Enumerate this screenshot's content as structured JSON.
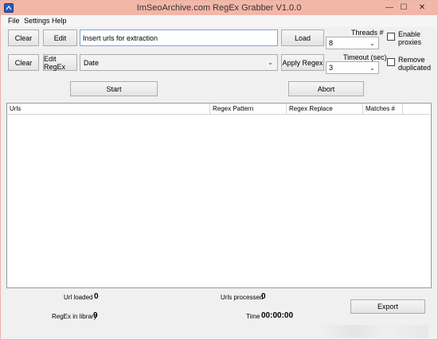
{
  "window": {
    "title": "ImSeoArchive.com RegEx Grabber V1.0.0",
    "controls": {
      "minimize": "—",
      "maximize": "☐",
      "close": "✕"
    }
  },
  "menu": [
    "File",
    "Settings",
    "Help"
  ],
  "row1": {
    "clear_label": "Clear",
    "edit_label": "Edit",
    "url_input_value": "Insert urls for extraction",
    "load_label": "Load",
    "threads_label": "Threads #",
    "threads_value": "8",
    "enable_proxies_label_1": "Enable",
    "enable_proxies_label_2": "proxies",
    "enable_proxies_checked": false
  },
  "row2": {
    "clear_label": "Clear",
    "edit_regex_label": "Edit RegEx",
    "regex_select_value": "Date",
    "apply_regex_label": "Apply Regex",
    "timeout_label": "Timeout (sec)",
    "timeout_value": "3",
    "remove_dup_label_1": "Remove",
    "remove_dup_label_2": "duplicated",
    "remove_dup_checked": false
  },
  "actions": {
    "start_label": "Start",
    "abort_label": "Abort"
  },
  "grid": {
    "columns": [
      "Urls",
      "Regex Pattern",
      "Regex Replace",
      "Matches #"
    ],
    "rows": []
  },
  "stats": {
    "url_loaded_label": "Url loaded",
    "url_loaded_value": "0",
    "urls_processed_label": "Urls processed",
    "urls_processed_value": "0",
    "regex_library_label": "RegEx in library",
    "regex_library_value": "9",
    "time_label": "Time",
    "time_value": "00:00:00",
    "export_label": "Export"
  },
  "colors": {
    "titlebar": "#f3b7a8",
    "accent": "#2a5cb8"
  }
}
